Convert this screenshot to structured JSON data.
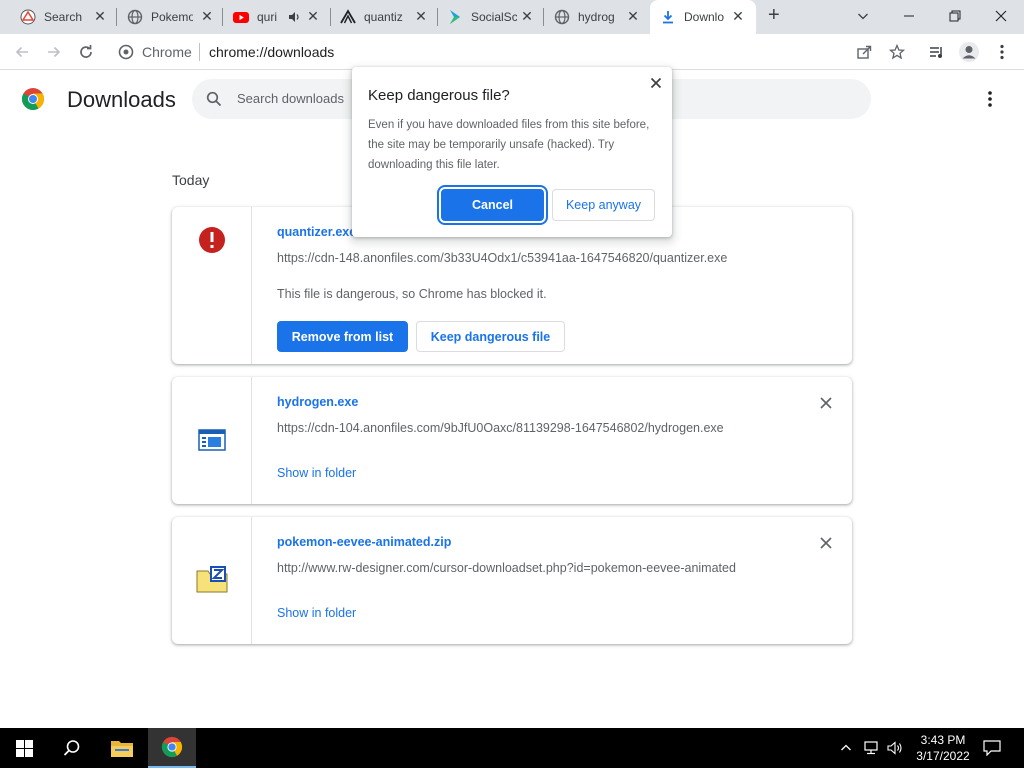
{
  "tabs": [
    {
      "title": "Search",
      "icon": "google-drive-icon"
    },
    {
      "title": "Pokemo",
      "icon": "globe-icon"
    },
    {
      "title": "quri",
      "icon": "youtube-icon"
    },
    {
      "title": "quantiz",
      "icon": "quantizer-icon"
    },
    {
      "title": "SocialSc",
      "icon": "socialsc-icon"
    },
    {
      "title": "hydrog",
      "icon": "globe-icon"
    },
    {
      "title": "Downlo",
      "icon": "download-icon"
    }
  ],
  "omnibox": {
    "scheme_label": "Chrome",
    "url": "chrome://downloads"
  },
  "page": {
    "title": "Downloads",
    "search_placeholder": "Search downloads",
    "section_label": "Today"
  },
  "downloads": [
    {
      "filename": "quantizer.exe",
      "url": "https://cdn-148.anonfiles.com/3b33U4Odx1/c53941aa-1647546820/quantizer.exe",
      "status": "This file is dangerous, so Chrome has blocked it.",
      "primary_action": "Remove from list",
      "secondary_action": "Keep dangerous file",
      "icon": "danger-icon"
    },
    {
      "filename": "hydrogen.exe",
      "url": "https://cdn-104.anonfiles.com/9bJfU0Oaxc/81139298-1647546802/hydrogen.exe",
      "action": "Show in folder",
      "icon": "exe-file-icon"
    },
    {
      "filename": "pokemon-eevee-animated.zip",
      "url": "http://www.rw-designer.com/cursor-downloadset.php?id=pokemon-eevee-animated",
      "action": "Show in folder",
      "icon": "zip-file-icon"
    }
  ],
  "dialog": {
    "title": "Keep dangerous file?",
    "body": "Even if you have downloaded files from this site before, the site may be temporarily unsafe (hacked). Try downloading this file later.",
    "cancel_label": "Cancel",
    "keep_label": "Keep anyway"
  },
  "taskbar": {
    "time": "3:43 PM",
    "date": "3/17/2022"
  },
  "colors": {
    "accent": "#1a73e8",
    "danger": "#c5221f",
    "tabstrip": "#dee1e6"
  }
}
